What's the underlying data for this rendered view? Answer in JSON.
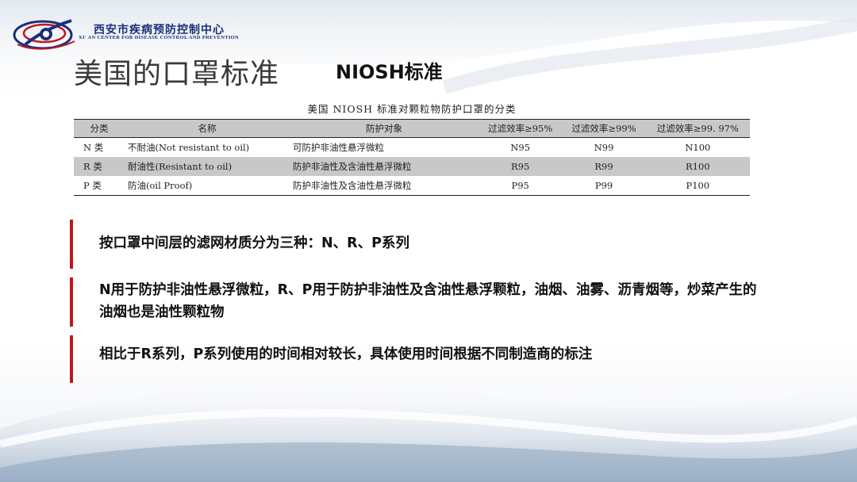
{
  "header": {
    "org_name_cn": "西安市疾病预防控制中心",
    "org_name_en": "XI' AN CENTER FOR DISEASE CONTROL AND PREVENTION",
    "logo_icon": "cdc-logo-icon"
  },
  "title": "美国的口罩标准",
  "subtitle": "NIOSH标准",
  "table": {
    "caption": "美国 NIOSH 标准对颗粒物防护口罩的分类",
    "headers": [
      "分类",
      "名称",
      "防护对象",
      "过滤效率≥95%",
      "过滤效率≥99%",
      "过滤效率≥99. 97%"
    ],
    "rows": [
      [
        "N 类",
        "不耐油(Not resistant to oil)",
        "可防护非油性悬浮微粒",
        "N95",
        "N99",
        "N100"
      ],
      [
        "R 类",
        "耐油性(Resistant to oil)",
        "防护非油性及含油性悬浮微粒",
        "R95",
        "R99",
        "R100"
      ],
      [
        "P 类",
        "防油(oil Proof)",
        "防护非油性及含油性悬浮微粒",
        "P95",
        "P99",
        "P100"
      ]
    ]
  },
  "bullets": [
    "按口罩中间层的滤网材质分为三种：N、R、P系列",
    "N用于防护非油性悬浮微粒，R、P用于防护非油性及含油性悬浮颗粒，油烟、油雾、沥青烟等，炒菜产生的油烟也是油性颗粒物",
    "相比于R系列，P系列使用的时间相对较长，具体使用时间根据不同制造商的标注"
  ],
  "colors": {
    "accent_bar": "#c0161c",
    "org_blue": "#1b2f7a",
    "table_shade": "#c8c8c8"
  }
}
